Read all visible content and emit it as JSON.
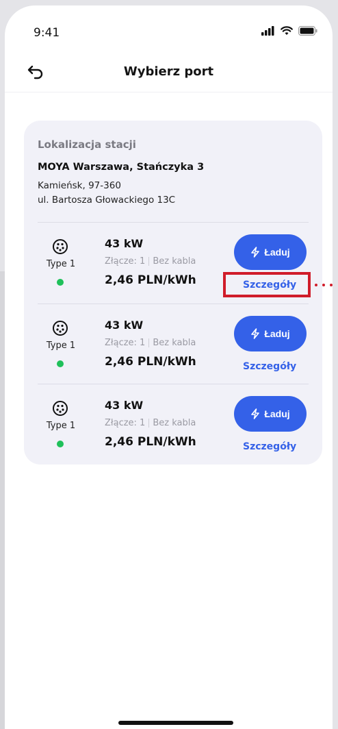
{
  "status_bar": {
    "time": "9:41"
  },
  "header": {
    "title": "Wybierz port"
  },
  "location": {
    "label": "Lokalizacja stacji",
    "name": "MOYA Warszawa, Stańczyka 3",
    "city_line": "Kamieńsk, 97-360",
    "street_line": "ul. Bartosza Głowackiego 13C"
  },
  "ports": [
    {
      "type": "Type 1",
      "power": "43 kW",
      "connector": "Złącze: 1",
      "cable": "Bez kabla",
      "price": "2,46 PLN/kWh",
      "charge_label": "Ładuj",
      "details_label": "Szczegóły"
    },
    {
      "type": "Type 1",
      "power": "43 kW",
      "connector": "Złącze: 1",
      "cable": "Bez kabla",
      "price": "2,46 PLN/kWh",
      "charge_label": "Ładuj",
      "details_label": "Szczegóły"
    },
    {
      "type": "Type 1",
      "power": "43 kW",
      "connector": "Złącze: 1",
      "cable": "Bez kabla",
      "price": "2,46 PLN/kWh",
      "charge_label": "Ładuj",
      "details_label": "Szczegóły"
    }
  ],
  "colors": {
    "accent": "#3461e8",
    "available": "#1fc05a",
    "highlight": "#d01c2a",
    "card_bg": "#f1f1f8"
  },
  "icons": {
    "back": "back-arrow-icon",
    "connector": "type1-connector-icon",
    "bolt": "lightning-bolt-icon"
  }
}
